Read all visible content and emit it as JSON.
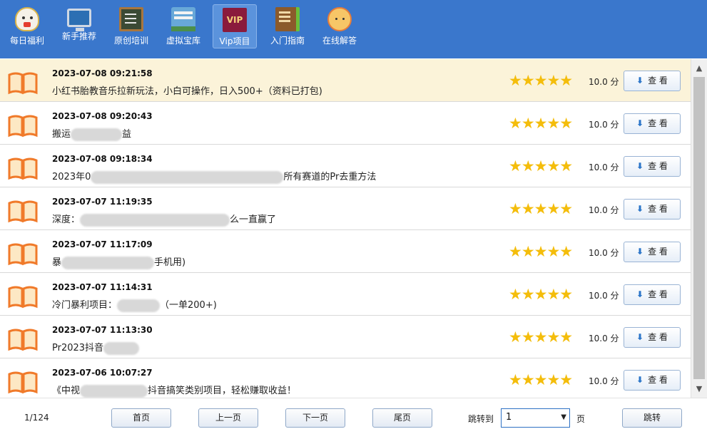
{
  "toolbar": {
    "items": [
      {
        "label": "每日福利",
        "icon": "lucky-cat-icon"
      },
      {
        "label": "新手推荐",
        "icon": "monitor-icon"
      },
      {
        "label": "原创培训",
        "icon": "blackboard-icon"
      },
      {
        "label": "虚拟宝库",
        "icon": "warehouse-icon"
      },
      {
        "label": "Vip项目",
        "icon": "vip-icon",
        "badge": "VIP",
        "active": true
      },
      {
        "label": "入门指南",
        "icon": "book-icon"
      },
      {
        "label": "在线解答",
        "icon": "support-agent-icon"
      }
    ]
  },
  "list": {
    "rows": [
      {
        "date": "2023-07-08 09:21:58",
        "title_pre": "小红书胎教音乐拉新玩法，小白可操作，日入500+（资料已打包)",
        "title_post": "",
        "redacted": false,
        "stars": "★★★★★",
        "score": "10.0 分",
        "button": "查 看"
      },
      {
        "date": "2023-07-08 09:20:43",
        "title_pre": "搬运",
        "title_post": "益",
        "redacted": true,
        "stars": "★★★★★",
        "score": "10.0 分",
        "button": "查 看"
      },
      {
        "date": "2023-07-08 09:18:34",
        "title_pre": "2023年0",
        "title_post": "所有赛道的Pr去重方法",
        "redacted": true,
        "stars": "★★★★★",
        "score": "10.0 分",
        "button": "查 看"
      },
      {
        "date": "2023-07-07 11:19:35",
        "title_pre": "深度：",
        "title_post": "么一直赢了",
        "redacted": true,
        "stars": "★★★★★",
        "score": "10.0 分",
        "button": "查 看"
      },
      {
        "date": "2023-07-07 11:17:09",
        "title_pre": "暴",
        "title_post": "手机用)",
        "redacted": true,
        "stars": "★★★★★",
        "score": "10.0 分",
        "button": "查 看"
      },
      {
        "date": "2023-07-07 11:14:31",
        "title_pre": "冷门暴利项目：",
        "title_post": "（一单200+)",
        "redacted": true,
        "stars": "★★★★★",
        "score": "10.0 分",
        "button": "查 看"
      },
      {
        "date": "2023-07-07 11:13:30",
        "title_pre": "Pr2023抖音",
        "title_post": "",
        "redacted": true,
        "stars": "★★★★★",
        "score": "10.0 分",
        "button": "查 看"
      },
      {
        "date": "2023-07-06 10:07:27",
        "title_pre": "《中视",
        "title_post": "抖音搞笑类别项目，轻松赚取收益！",
        "redacted": true,
        "stars": "★★★★★",
        "score": "10.0 分",
        "button": "查 看"
      }
    ],
    "rating_fraction": 1.0
  },
  "footer": {
    "page_info": "1/124",
    "first": "首页",
    "prev": "上一页",
    "next": "下一页",
    "last": "尾页",
    "jump_label": "跳转到",
    "page_value": "1",
    "page_unit": "页",
    "go": "跳转"
  },
  "colors": {
    "toolbar_bg": "#3a77cc",
    "highlight_row": "#fbf3d9",
    "star": "#f4bd0b",
    "book_icon": "#f07a2a",
    "button_arrow": "#2a74c8"
  }
}
